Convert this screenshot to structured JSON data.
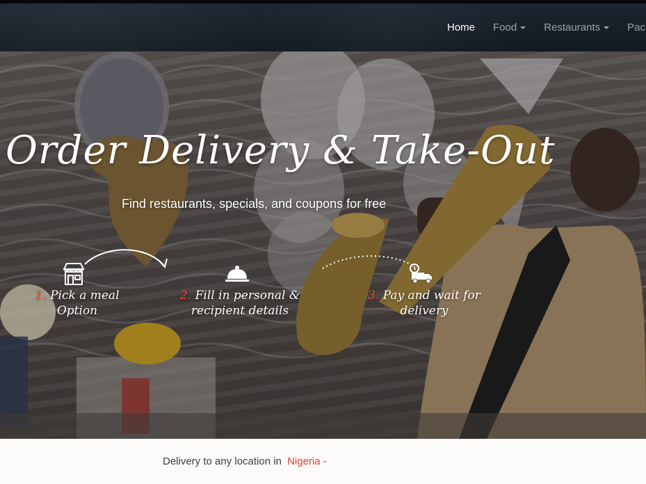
{
  "nav": {
    "items": [
      {
        "label": "Home",
        "dropdown": false,
        "active": true
      },
      {
        "label": "Food",
        "dropdown": true,
        "active": false
      },
      {
        "label": "Restaurants",
        "dropdown": true,
        "active": false
      },
      {
        "label": "Pac",
        "dropdown": false,
        "active": false
      }
    ]
  },
  "hero": {
    "title": "Order Delivery & Take-Out",
    "subtitle": "Find restaurants, specials, and coupons for free",
    "steps": [
      {
        "num": "1.",
        "text_line1": "Pick a meal",
        "text_line2": "Option",
        "icon": "storefront-icon"
      },
      {
        "num": "2.",
        "text_line1": "Fill in personal &",
        "text_line2": "recipient details",
        "icon": "cloche-icon"
      },
      {
        "num": "3.",
        "text_line1": "Pay and wait for",
        "text_line2": "delivery",
        "icon": "delivery-truck-icon"
      }
    ]
  },
  "delivery": {
    "prefix": "Delivery to any location in",
    "country": "Nigeria",
    "suffix": "-"
  },
  "colors": {
    "nav_bg": "#141c25",
    "accent_red": "#e53935",
    "step_number": "#e74c3c"
  }
}
